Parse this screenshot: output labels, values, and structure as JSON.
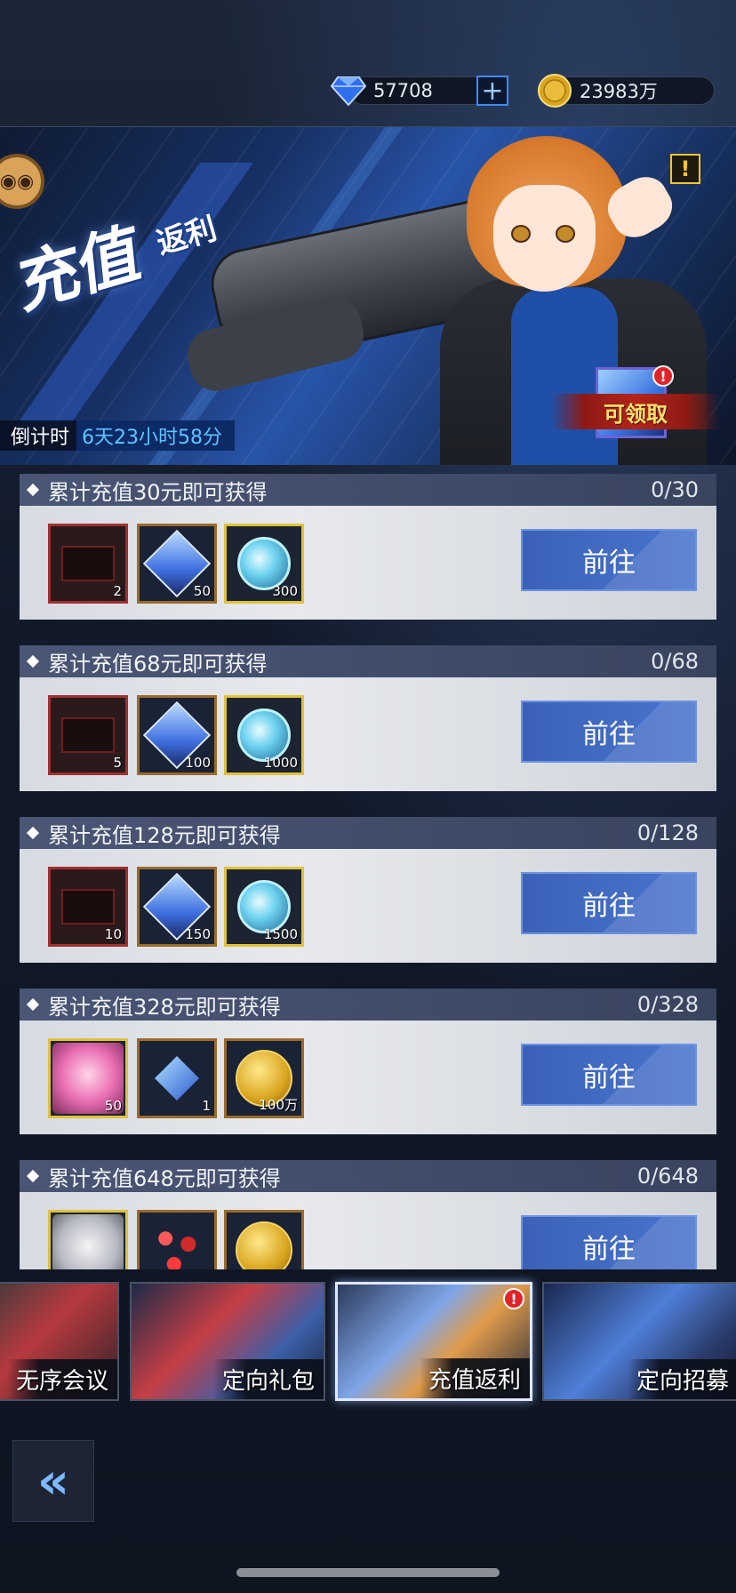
{
  "currency": {
    "gems": "57708",
    "gems_icon": "blue-diamond-icon",
    "plus_label": "+",
    "gold": "23983万",
    "gold_icon": "gold-coin-icon"
  },
  "banner": {
    "title": "充值",
    "subtitle": "返利",
    "warning_label": "!",
    "countdown_label": "倒计时",
    "countdown_value": "6天23小时58分",
    "claim_label": "可领取",
    "claim_badge": "!"
  },
  "tiers": [
    {
      "title": "累计充值30元即可获得",
      "progress": "0/30",
      "button": "前往",
      "rewards": [
        {
          "icon": "red-ticket-icon",
          "count": "2"
        },
        {
          "icon": "blue-crystal-icon",
          "count": "50"
        },
        {
          "icon": "cyan-orb-icon",
          "count": "300"
        }
      ]
    },
    {
      "title": "累计充值68元即可获得",
      "progress": "0/68",
      "button": "前往",
      "rewards": [
        {
          "icon": "red-ticket-icon",
          "count": "5"
        },
        {
          "icon": "blue-crystal-icon",
          "count": "100"
        },
        {
          "icon": "cyan-orb-icon",
          "count": "1000"
        }
      ]
    },
    {
      "title": "累计充值128元即可获得",
      "progress": "0/128",
      "button": "前往",
      "rewards": [
        {
          "icon": "red-ticket-icon",
          "count": "10"
        },
        {
          "icon": "blue-crystal-icon",
          "count": "150"
        },
        {
          "icon": "cyan-orb-icon",
          "count": "1500"
        }
      ]
    },
    {
      "title": "累计充值328元即可获得",
      "progress": "0/328",
      "button": "前往",
      "rewards": [
        {
          "icon": "pink-character-portrait-icon",
          "count": "50"
        },
        {
          "icon": "blue-chip-icon",
          "count": "1"
        },
        {
          "icon": "gold-coin-icon",
          "count": "100万"
        }
      ]
    },
    {
      "title": "累计充值648元即可获得",
      "progress": "0/648",
      "button": "前往",
      "rewards": [
        {
          "icon": "white-character-portrait-icon",
          "count": ""
        },
        {
          "icon": "red-shards-icon",
          "count": ""
        },
        {
          "icon": "gold-coin-icon",
          "count": ""
        }
      ]
    }
  ],
  "tabs": [
    {
      "label": "无序会议",
      "active": false
    },
    {
      "label": "定向礼包",
      "active": false
    },
    {
      "label": "充值返利",
      "active": true,
      "badge": "!"
    },
    {
      "label": "定向招募",
      "active": false
    }
  ],
  "back_icon": "double-chevron-left-icon",
  "back_glyph": "«",
  "colors": {
    "accent_blue": "#4a74cc",
    "countdown": "#5fc4ff",
    "claim_text": "#ffe36a",
    "alert_red": "#e0242a"
  }
}
